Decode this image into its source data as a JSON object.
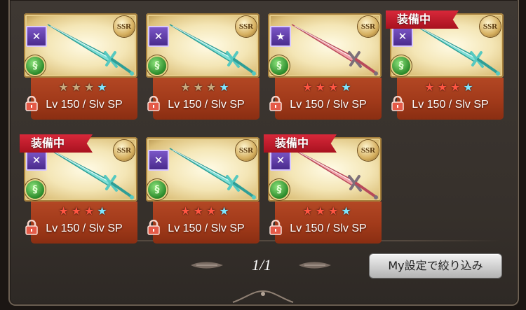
{
  "weapons": [
    {
      "type_icon": "✕",
      "element_icon": "§",
      "stars": [
        "dim",
        "dim",
        "dim",
        "blue"
      ],
      "level_text": "Lv 150 / Slv SP",
      "equipped": false,
      "blade": "teal"
    },
    {
      "type_icon": "✕",
      "element_icon": "§",
      "stars": [
        "dim",
        "dim",
        "dim",
        "blue"
      ],
      "level_text": "Lv 150 / Slv SP",
      "equipped": false,
      "blade": "teal"
    },
    {
      "type_icon": "★",
      "element_icon": "§",
      "stars": [
        "red",
        "red",
        "red",
        "blue"
      ],
      "level_text": "Lv 150 / Slv SP",
      "equipped": false,
      "blade": "red"
    },
    {
      "type_icon": "✕",
      "element_icon": "§",
      "stars": [
        "red",
        "red",
        "red",
        "blue"
      ],
      "level_text": "Lv 150 / Slv SP",
      "equipped": true,
      "blade": "teal"
    },
    {
      "type_icon": "✕",
      "element_icon": "§",
      "stars": [
        "red",
        "red",
        "red",
        "blue"
      ],
      "level_text": "Lv 150 / Slv SP",
      "equipped": true,
      "blade": "teal"
    },
    {
      "type_icon": "✕",
      "element_icon": "§",
      "stars": [
        "red",
        "red",
        "red",
        "blue"
      ],
      "level_text": "Lv 150 / Slv SP",
      "equipped": false,
      "blade": "teal"
    },
    {
      "type_icon": "✕",
      "element_icon": "§",
      "stars": [
        "red",
        "red",
        "red",
        "blue"
      ],
      "level_text": "Lv 150 / Slv SP",
      "equipped": true,
      "blade": "red"
    }
  ],
  "labels": {
    "rarity": "SSR",
    "equipped": "装備中"
  },
  "pagination": {
    "page_text": "1/1"
  },
  "filter_button": {
    "label": "My設定で絞り込み"
  },
  "colors": {
    "panel_bg": "#3a342f",
    "info_bg": "#a13a1a",
    "star_red": "#ff5542",
    "star_blue": "#7fe6ff",
    "equipped_ribbon": "#c41e2e"
  }
}
